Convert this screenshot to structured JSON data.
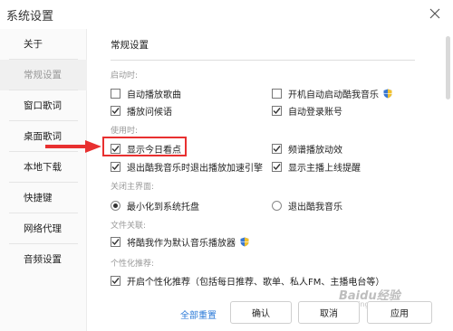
{
  "window": {
    "title": "系统设置"
  },
  "sidebar": {
    "items": [
      {
        "label": "关于",
        "active": false
      },
      {
        "label": "常规设置",
        "active": true
      },
      {
        "label": "窗口歌词",
        "active": false
      },
      {
        "label": "桌面歌词",
        "active": false
      },
      {
        "label": "本地下载",
        "active": false
      },
      {
        "label": "快捷键",
        "active": false
      },
      {
        "label": "网络代理",
        "active": false
      },
      {
        "label": "音频设置",
        "active": false
      }
    ]
  },
  "main": {
    "section_title": "常规设置",
    "groups": {
      "startup": {
        "label": "启动时:",
        "options": [
          {
            "label": "自动播放歌曲",
            "checked": false
          },
          {
            "label": "开机自动启动酷我音乐",
            "checked": false,
            "icon": "shield-icon"
          },
          {
            "label": "播放问候语",
            "checked": true
          },
          {
            "label": "自动登录账号",
            "checked": true
          }
        ]
      },
      "usage": {
        "label": "使用时:",
        "options": [
          {
            "label": "显示今日看点",
            "checked": true
          },
          {
            "label": "频谱播放动效",
            "checked": true
          },
          {
            "label": "退出酷我音乐时退出播放加速引擎",
            "checked": true
          },
          {
            "label": "显示主播上线提醒",
            "checked": true
          }
        ]
      },
      "close_main": {
        "label": "关闭主界面:",
        "options": [
          {
            "label": "最小化到系统托盘",
            "selected": true
          },
          {
            "label": "退出酷我音乐",
            "selected": false
          }
        ]
      },
      "file_assoc": {
        "label": "文件关联:",
        "options": [
          {
            "label": "将酷我作为默认音乐播放器",
            "checked": true,
            "icon": "shield-icon"
          }
        ]
      },
      "personalization": {
        "label": "个性化推荐:",
        "options": [
          {
            "label": "开启个性化推荐（包括每日推荐、歌单、私人FM、主播电台等）",
            "checked": true
          }
        ]
      }
    }
  },
  "footer": {
    "reset_label": "全部重置",
    "ok_label": "确认",
    "cancel_label": "取消",
    "apply_label": "应用"
  },
  "watermark": {
    "text": "Baidu经验",
    "sub": "jingyan.baidu.com"
  },
  "colors": {
    "accent": "#2b7ad8",
    "highlight": "#e83030",
    "check": "#333333"
  }
}
